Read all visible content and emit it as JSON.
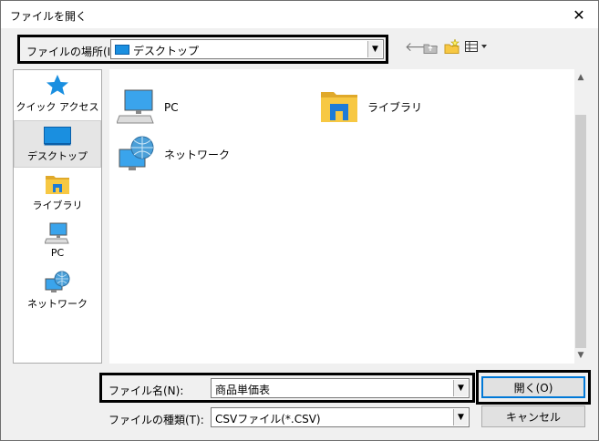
{
  "window": {
    "title": "ファイルを開く",
    "close_icon": "✕"
  },
  "look_in": {
    "label": "ファイルの場所(I):",
    "value": "デスクトップ"
  },
  "toolbar": {
    "back_icon": "🡐",
    "up_icon": "⇧",
    "new_folder_icon": "✦",
    "view_icon": "▦▾"
  },
  "places": [
    {
      "label": "クイック アクセス"
    },
    {
      "label": "デスクトップ"
    },
    {
      "label": "ライブラリ"
    },
    {
      "label": "PC"
    },
    {
      "label": "ネットワーク"
    }
  ],
  "items": [
    {
      "label": "PC"
    },
    {
      "label": "ライブラリ"
    },
    {
      "label": "ネットワーク"
    }
  ],
  "filename": {
    "label": "ファイル名(N):",
    "value": "商品単価表"
  },
  "filetype": {
    "label": "ファイルの種類(T):",
    "value": "CSVファイル(*.CSV)"
  },
  "buttons": {
    "open": "開く(O)",
    "cancel": "キャンセル"
  },
  "colors": {
    "folder_yellow": "#f7c843",
    "folder_dark": "#e0a92a",
    "library_blue": "#1e7bd7",
    "monitor_blue": "#1a8fe0"
  }
}
